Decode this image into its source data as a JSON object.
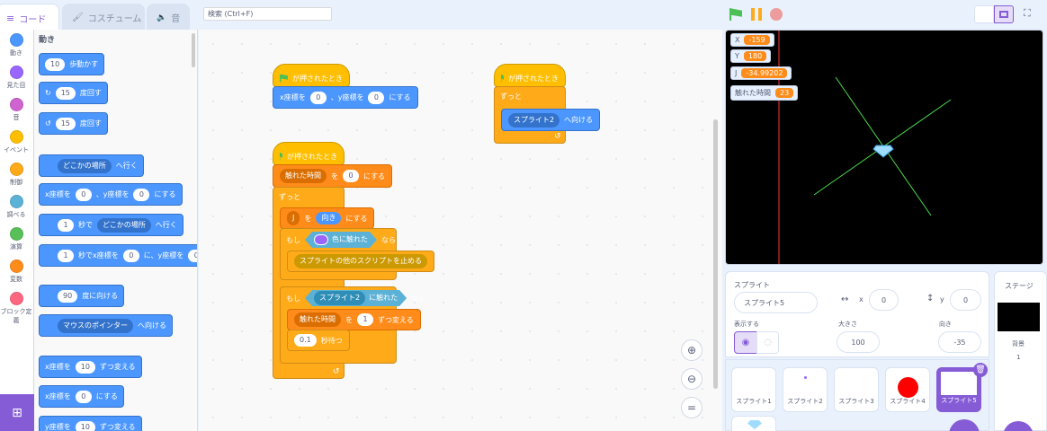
{
  "tabs": {
    "code": "コード",
    "costume": "コスチューム",
    "sound": "音"
  },
  "search": {
    "label": "検索 (Ctrl+F)"
  },
  "categories": [
    {
      "label": "動き",
      "color": "#4c97ff"
    },
    {
      "label": "見た目",
      "color": "#9966ff"
    },
    {
      "label": "音",
      "color": "#cf63cf"
    },
    {
      "label": "イベント",
      "color": "#ffbf00"
    },
    {
      "label": "制御",
      "color": "#ffab19"
    },
    {
      "label": "調べる",
      "color": "#5cb1d6"
    },
    {
      "label": "演算",
      "color": "#59c059"
    },
    {
      "label": "変数",
      "color": "#ff8c1a"
    },
    {
      "label": "ブロック定義",
      "color": "#ff6680"
    }
  ],
  "palette": {
    "header": "動き",
    "move_val": "10",
    "move_label": "歩動かす",
    "turn_r_val": "15",
    "turn_r_label": "度回す",
    "turn_l_val": "15",
    "turn_l_label": "度回す",
    "goto_dd": "どこかの場所",
    "goto_label": "へ行く",
    "setxy_x_label": "x座標を",
    "setxy_x": "0",
    "setxy_y_label": "、y座標を",
    "setxy_y": "0",
    "setxy_end": "にする",
    "glide_val": "1",
    "glide_label": "秒で",
    "glide_dd": "どこかの場所",
    "glide_end": "へ行く",
    "glidexy_val": "1",
    "glidexy_label": "秒でx座標を",
    "glidexy_x": "0",
    "glidexy_mid": "に、y座標を",
    "glidexy_y": "0",
    "point_val": "90",
    "point_label": "度に向ける",
    "pointto_dd": "マウスのポインター",
    "pointto_label": "へ向ける",
    "changex_label": "x座標を",
    "changex_val": "10",
    "changex_end": "ずつ変える",
    "setx_label": "x座標を",
    "setx_val": "0",
    "setx_end": "にする",
    "changey_label": "y座標を",
    "changey_val": "10",
    "changey_end": "ずつ変える"
  },
  "scripts": {
    "s1": {
      "hat": "が押されたとき",
      "setxy_x_label": "x座標を",
      "x": "0",
      "setxy_y_label": "、y座標を",
      "y": "0",
      "end": "にする"
    },
    "s2": {
      "hat": "が押されたとき",
      "forever": "ずっと",
      "point_dd": "スプライト2",
      "point_label": "へ向ける"
    },
    "s3": {
      "hat": "が押されたとき",
      "setvar_dd": "触れた時間",
      "setvar_to": "を",
      "setvar_val": "0",
      "setvar_end": "にする",
      "forever": "ずっと",
      "setj_dd": "J",
      "setj_to": "を",
      "setj_val": "向き",
      "setj_end": "にする",
      "if1": "もし",
      "if1_cond": "色に触れた",
      "if1_then": "なら",
      "stop_dd": "スプライトの他のスクリプトを止める",
      "if2": "もし",
      "if2_dd": "スプライト2",
      "if2_cond": "に触れた",
      "if2_then": "なら",
      "change_dd": "触れた時間",
      "change_to": "を",
      "change_val": "1",
      "change_end": "ずつ変える",
      "wait_val": "0.1",
      "wait_label": "秒待つ"
    }
  },
  "monitors": [
    {
      "label": "X",
      "value": "-159"
    },
    {
      "label": "Y",
      "value": "180"
    },
    {
      "label": "J",
      "value": "-34.99202"
    },
    {
      "label": "触れた時間",
      "value": "23"
    }
  ],
  "sprite_info": {
    "header": "スプライト",
    "name": "スプライト5",
    "x_label": "x",
    "x": "0",
    "y_label": "y",
    "y": "0",
    "show_label": "表示する",
    "size_label": "大きさ",
    "size": "100",
    "dir_label": "向き",
    "dir": "-35"
  },
  "sprites": [
    "スプライト1",
    "スプライト2",
    "スプライト3",
    "スプライト4",
    "スプライト5"
  ],
  "stage_pane": {
    "header": "ステージ",
    "bg_label": "背景",
    "bg_count": "1"
  },
  "colors": {
    "accent": "#855cd6",
    "motion": "#4c97ff",
    "events": "#ffbf00",
    "control": "#ffab19",
    "variables": "#ff8c1a",
    "sensing": "#5cb1d6"
  }
}
